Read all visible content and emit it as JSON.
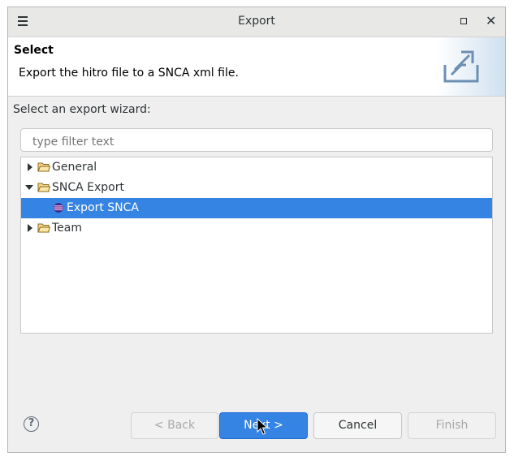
{
  "window": {
    "title": "Export"
  },
  "header": {
    "title": "Select",
    "description": "Export the hitro file to a SNCA xml file."
  },
  "wizard": {
    "select_label": "Select an export wizard:",
    "filter_placeholder": "type filter text",
    "tree": [
      {
        "label": "General",
        "expanded": false,
        "icon": "folder-icon"
      },
      {
        "label": "SNCA Export",
        "expanded": true,
        "icon": "folder-open-icon"
      },
      {
        "label": "Export SNCA",
        "selected": true,
        "icon": "snca-icon"
      },
      {
        "label": "Team",
        "expanded": false,
        "icon": "folder-icon"
      }
    ]
  },
  "buttons": {
    "help": "?",
    "back": "< Back",
    "next": "Next >",
    "cancel": "Cancel",
    "finish": "Finish"
  },
  "colors": {
    "selection": "#3584e4",
    "primary_button": "#3584e4",
    "folder": "#e8b84a"
  }
}
